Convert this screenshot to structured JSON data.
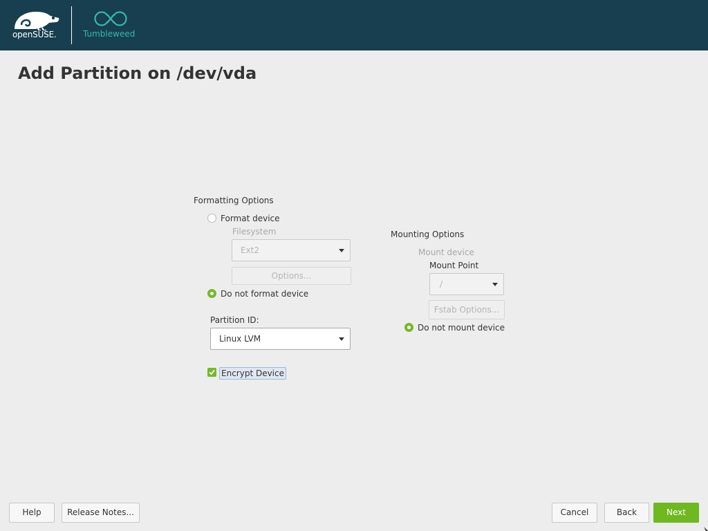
{
  "header": {
    "brand_text": "openSUSE",
    "brand_trademark": ".",
    "product_text": "Tumbleweed"
  },
  "page": {
    "title": "Add Partition on /dev/vda"
  },
  "formatting": {
    "title": "Formatting Options",
    "format_device_label": "Format device",
    "format_device_checked": false,
    "filesystem_label": "Filesystem",
    "filesystem_value": "Ext2",
    "options_button": "Options...",
    "do_not_format_label": "Do not format device",
    "do_not_format_checked": true,
    "partition_id_label": "Partition ID:",
    "partition_id_value": "Linux LVM",
    "encrypt_label": "Encrypt Device",
    "encrypt_checked": true
  },
  "mounting": {
    "title": "Mounting Options",
    "mount_device_label": "Mount device",
    "mount_point_label": "Mount Point",
    "mount_point_value": "/",
    "fstab_button": "Fstab Options...",
    "do_not_mount_label": "Do not mount device",
    "do_not_mount_checked": true
  },
  "footer": {
    "help": "Help",
    "release_notes": "Release Notes...",
    "cancel": "Cancel",
    "back": "Back",
    "next": "Next"
  },
  "icons": {
    "brand_logo": "opensuse-chameleon-icon",
    "product_logo": "tumbleweed-infinity-icon",
    "dropdown": "chevron-down-icon",
    "check": "checkmark-icon"
  },
  "colors": {
    "header_bg": "#173f4f",
    "accent_green": "#73ba25",
    "tumbleweed_teal": "#35b9ab",
    "page_bg": "#ededed"
  }
}
